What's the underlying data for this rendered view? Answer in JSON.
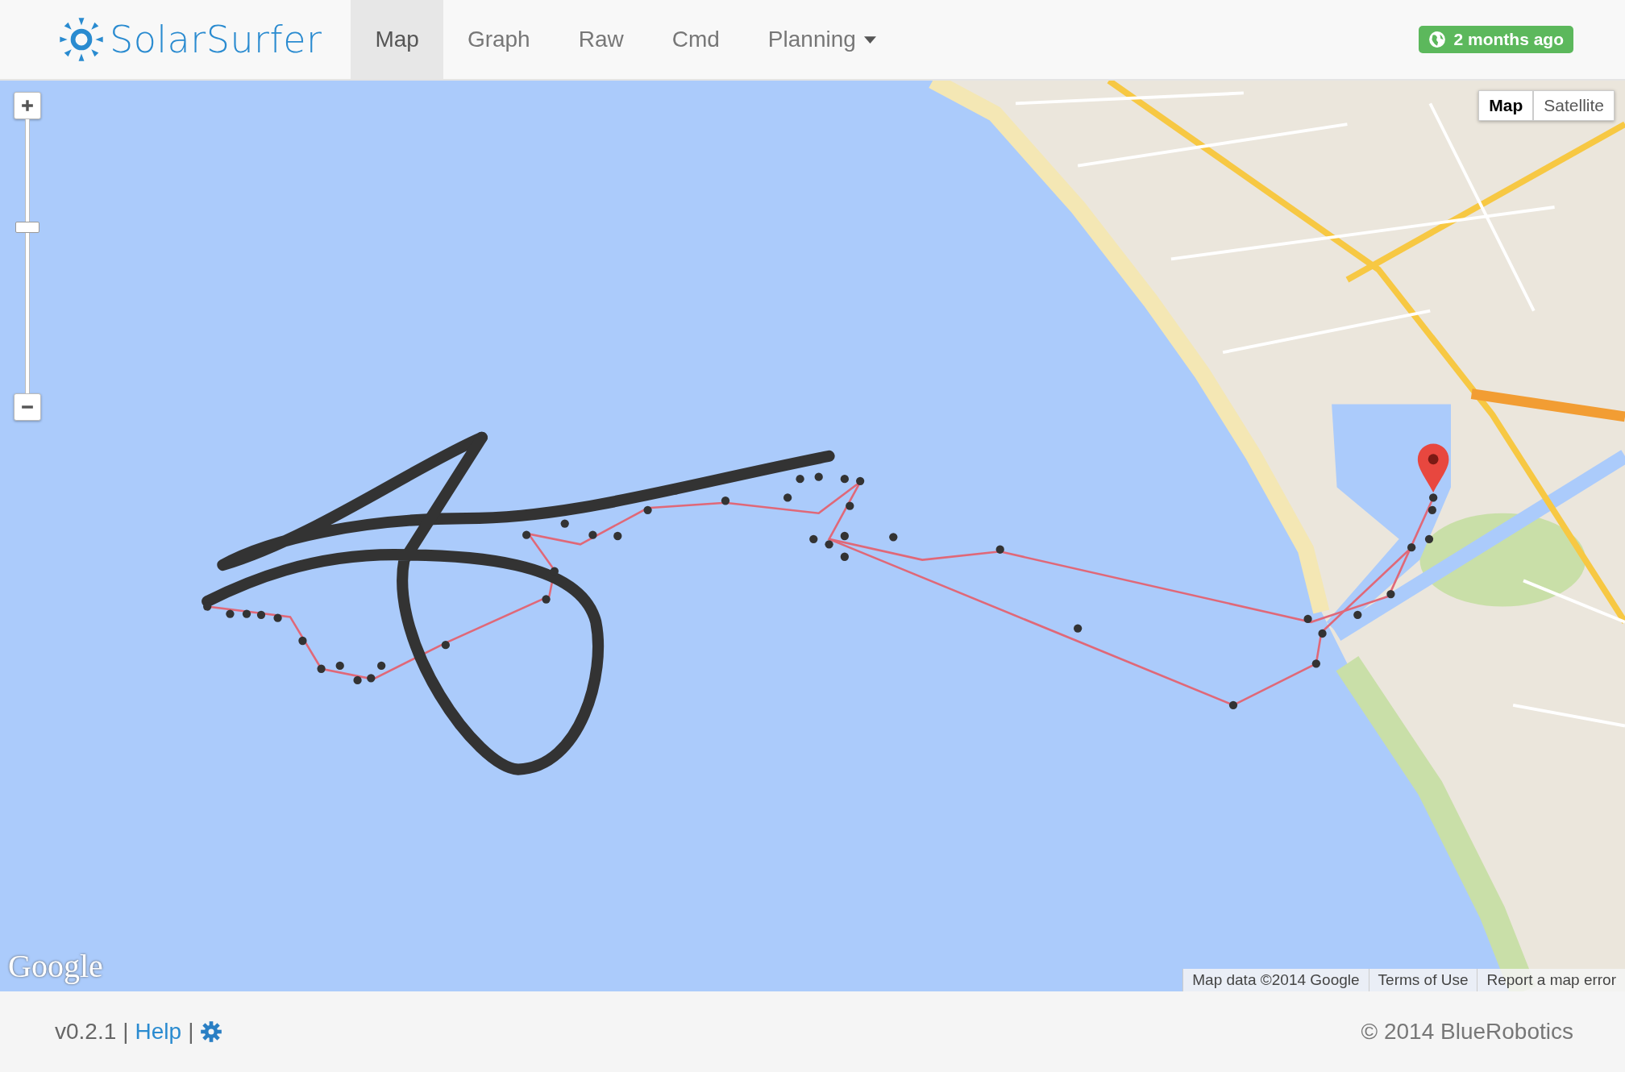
{
  "header": {
    "brand": "SolarSurfer",
    "tabs": [
      {
        "label": "Map",
        "selected": true,
        "kind": "link"
      },
      {
        "label": "Graph",
        "selected": false,
        "kind": "link"
      },
      {
        "label": "Raw",
        "selected": false,
        "kind": "link"
      },
      {
        "label": "Cmd",
        "selected": false,
        "kind": "link"
      },
      {
        "label": "Planning",
        "selected": false,
        "kind": "dropdown"
      }
    ],
    "status_badge": "2 months ago"
  },
  "map": {
    "zoom": {
      "level": 0.61
    },
    "type_buttons": [
      {
        "label": "Map",
        "selected": true
      },
      {
        "label": "Satellite",
        "selected": false
      }
    ],
    "logo": "Google",
    "attribution": [
      "Map data ©2014 Google",
      "Terms of Use",
      "Report a map error"
    ]
  },
  "footer": {
    "version": "v0.2.1",
    "separator_1": "|",
    "help_link": "Help",
    "separator_2": "|",
    "copyright": "© 2014 BlueRobotics"
  }
}
